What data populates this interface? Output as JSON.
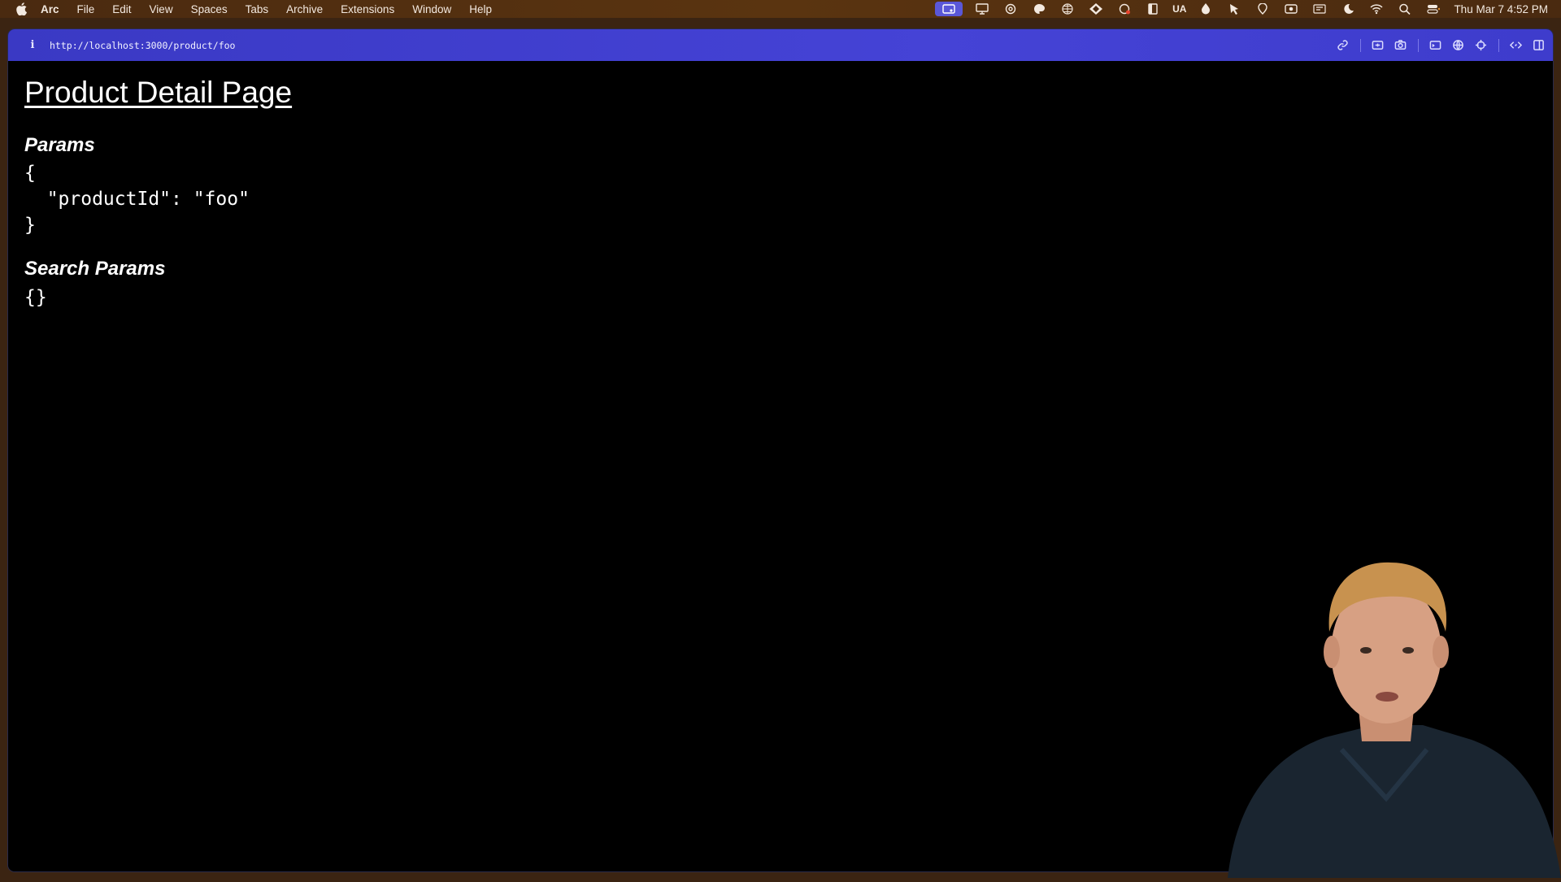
{
  "menubar": {
    "items": [
      "Arc",
      "File",
      "Edit",
      "View",
      "Spaces",
      "Tabs",
      "Archive",
      "Extensions",
      "Window",
      "Help"
    ],
    "tray_text": "UA",
    "clock": "Thu Mar 7  4:52 PM"
  },
  "browser": {
    "url": "http://localhost:3000/product/foo"
  },
  "page": {
    "title": "Product Detail Page",
    "params_heading": "Params",
    "params_json": "{\n  \"productId\": \"foo\"\n}",
    "search_params_heading": "Search Params",
    "search_params_json": "{}"
  },
  "colors": {
    "menubar": "#4a2a10",
    "toolbar": "#4543d6",
    "page_bg": "#000000",
    "text": "#ffffff"
  }
}
